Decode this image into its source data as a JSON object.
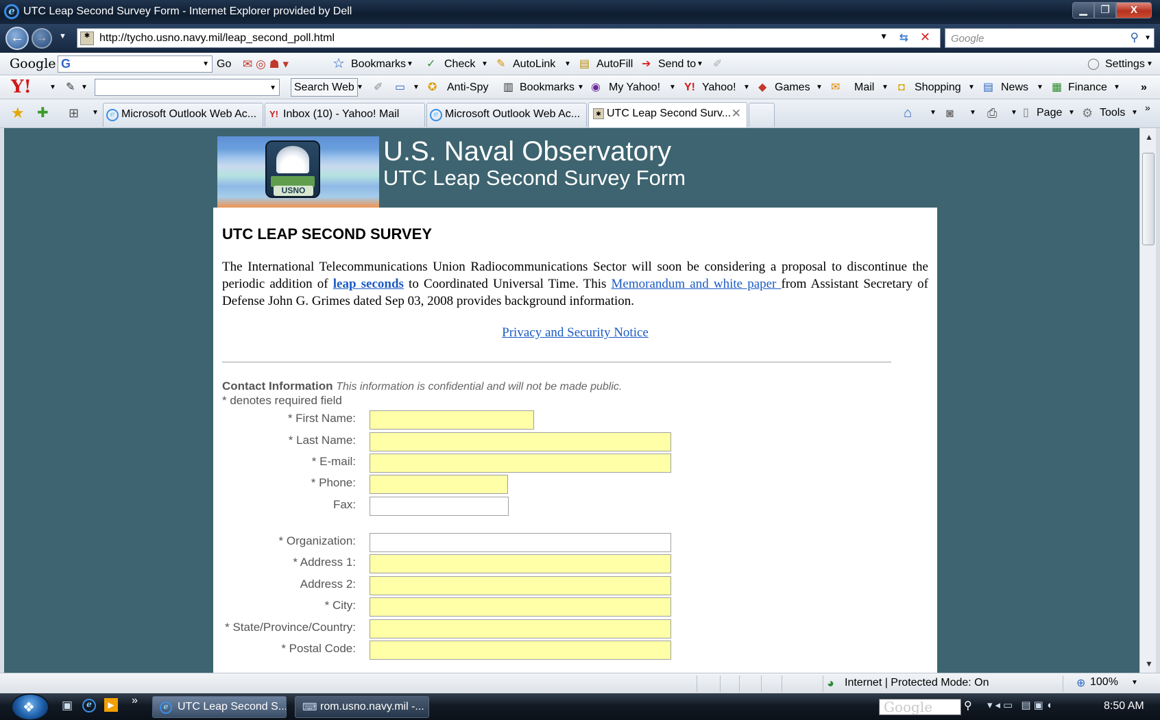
{
  "window": {
    "title": "UTC Leap Second Survey Form - Internet Explorer provided by Dell",
    "min_icon": "minimize-icon",
    "max_icon": "maximize-icon",
    "close_label": "X"
  },
  "nav": {
    "url": "http://tycho.usno.navy.mil/leap_second_poll.html",
    "search_placeholder": "Google"
  },
  "google_toolbar": {
    "logo": "Google",
    "go_label": "Go",
    "bookmarks_label": "Bookmarks",
    "check_label": "Check",
    "autolink_label": "AutoLink",
    "autofill_label": "AutoFill",
    "sendto_label": "Send to",
    "settings_label": "Settings"
  },
  "yahoo_toolbar": {
    "logo": "Y!",
    "search_web_label": "Search Web",
    "antispy_label": "Anti-Spy",
    "bookmarks_label": "Bookmarks",
    "myyahoo_label": "My Yahoo!",
    "yahoo_label": "Yahoo!",
    "games_label": "Games",
    "mail_label": "Mail",
    "shopping_label": "Shopping",
    "news_label": "News",
    "finance_label": "Finance",
    "more_label": "»"
  },
  "tabs": [
    {
      "label": "Microsoft Outlook Web Ac..."
    },
    {
      "label": "Inbox (10) - Yahoo! Mail"
    },
    {
      "label": "Microsoft Outlook Web Ac..."
    },
    {
      "label": "UTC Leap Second Surv..."
    }
  ],
  "command_bar": {
    "page_label": "Page",
    "tools_label": "Tools"
  },
  "header": {
    "org": "U.S. Naval Observatory",
    "subtitle": "UTC Leap Second Survey Form",
    "logo_text": "USNO"
  },
  "survey": {
    "heading": "UTC LEAP SECOND SURVEY",
    "intro_1": "The International Telecommunications Union Radiocommunications Sector will soon be considering a proposal to discontinue the periodic addition of ",
    "link_leap": "leap seconds",
    "intro_2": " to Coordinated Universal Time. This ",
    "link_memo": "Memorandum and white paper ",
    "intro_3": "from Assistant Secretary of Defense John G. Grimes dated Sep 03, 2008 provides background information.",
    "privacy_link": "Privacy and Security Notice",
    "contact_heading": "Contact Information",
    "contact_note": "This information is confidential and will not be made public.",
    "required_note": "* denotes required field"
  },
  "form": {
    "first_name": {
      "label": "* First Name:",
      "value": ""
    },
    "last_name": {
      "label": "* Last Name:",
      "value": ""
    },
    "email": {
      "label": "* E-mail:",
      "value": ""
    },
    "phone": {
      "label": "* Phone:",
      "value": ""
    },
    "fax": {
      "label": "Fax:",
      "value": ""
    },
    "organization": {
      "label": "* Organization:",
      "value": ""
    },
    "address1": {
      "label": "* Address 1:",
      "value": ""
    },
    "address2": {
      "label": "Address 2:",
      "value": ""
    },
    "city": {
      "label": "* City:",
      "value": ""
    },
    "state": {
      "label": "* State/Province/Country:",
      "value": ""
    },
    "postal": {
      "label": "* Postal Code:",
      "value": ""
    }
  },
  "status": {
    "zone": "Internet | Protected Mode: On",
    "zoom": "100%"
  },
  "taskbar": {
    "task1": "UTC Leap Second S...",
    "task2": "rom.usno.navy.mil -...",
    "google_box": "Google",
    "clock": "8:50 AM",
    "more": "»"
  },
  "colors": {
    "page_bg": "#3d6470",
    "required_field": "#ffffa8",
    "link": "#1a5bc4"
  }
}
